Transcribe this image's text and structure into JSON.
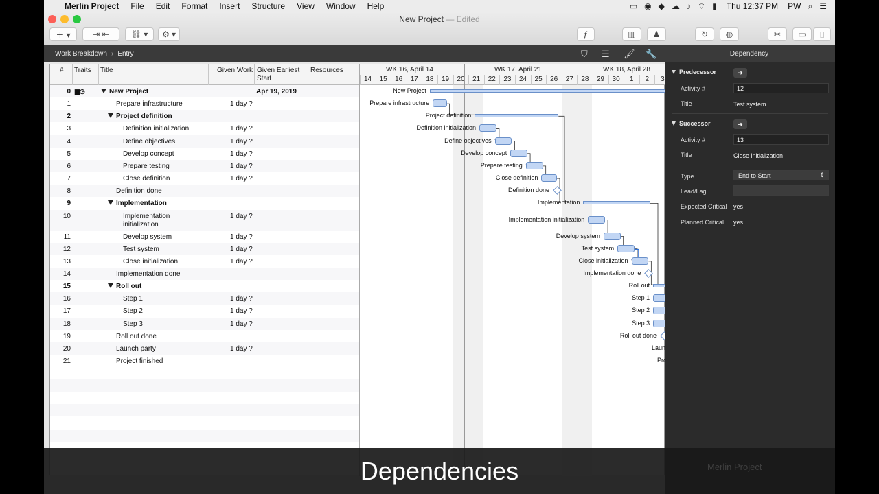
{
  "menubar": {
    "app": "Merlin Project",
    "items": [
      "File",
      "Edit",
      "Format",
      "Insert",
      "Structure",
      "View",
      "Window",
      "Help"
    ],
    "clock": "Thu 12:37 PM",
    "user": "PW"
  },
  "window": {
    "title": "New Project",
    "edited": "— Edited"
  },
  "breadcrumb": [
    "Work Breakdown",
    "Entry"
  ],
  "inspector_title": "Dependency",
  "columns": {
    "num": "#",
    "traits": "Traits",
    "title": "Title",
    "work": "Given Work",
    "start": "Given Earliest Start",
    "resources": "Resources"
  },
  "rows": [
    {
      "num": "0",
      "title": "New Project",
      "work": "",
      "start": "Apr 19, 2019",
      "level": 0,
      "group": true
    },
    {
      "num": "1",
      "title": "Prepare infrastructure",
      "work": "1 day ?",
      "start": "",
      "level": 1,
      "group": false
    },
    {
      "num": "2",
      "title": "Project definition",
      "work": "",
      "start": "",
      "level": 1,
      "group": true
    },
    {
      "num": "3",
      "title": "Definition initialization",
      "work": "1 day ?",
      "start": "",
      "level": 2,
      "group": false
    },
    {
      "num": "4",
      "title": "Define objectives",
      "work": "1 day ?",
      "start": "",
      "level": 2,
      "group": false
    },
    {
      "num": "5",
      "title": "Develop concept",
      "work": "1 day ?",
      "start": "",
      "level": 2,
      "group": false
    },
    {
      "num": "6",
      "title": "Prepare testing",
      "work": "1 day ?",
      "start": "",
      "level": 2,
      "group": false
    },
    {
      "num": "7",
      "title": "Close definition",
      "work": "1 day ?",
      "start": "",
      "level": 2,
      "group": false
    },
    {
      "num": "8",
      "title": "Definition done",
      "work": "",
      "start": "",
      "level": 1,
      "group": false
    },
    {
      "num": "9",
      "title": "Implementation",
      "work": "",
      "start": "",
      "level": 1,
      "group": true
    },
    {
      "num": "10",
      "title": "Implementation\ninitialization",
      "work": "1 day ?",
      "start": "",
      "level": 2,
      "group": false
    },
    {
      "num": "11",
      "title": "Develop system",
      "work": "1 day ?",
      "start": "",
      "level": 2,
      "group": false
    },
    {
      "num": "12",
      "title": "Test system",
      "work": "1 day ?",
      "start": "",
      "level": 2,
      "group": false
    },
    {
      "num": "13",
      "title": "Close initialization",
      "work": "1 day ?",
      "start": "",
      "level": 2,
      "group": false
    },
    {
      "num": "14",
      "title": "Implementation done",
      "work": "",
      "start": "",
      "level": 1,
      "group": false
    },
    {
      "num": "15",
      "title": "Roll out",
      "work": "",
      "start": "",
      "level": 1,
      "group": true
    },
    {
      "num": "16",
      "title": "Step 1",
      "work": "1 day ?",
      "start": "",
      "level": 2,
      "group": false
    },
    {
      "num": "17",
      "title": "Step 2",
      "work": "1 day ?",
      "start": "",
      "level": 2,
      "group": false
    },
    {
      "num": "18",
      "title": "Step 3",
      "work": "1 day ?",
      "start": "",
      "level": 2,
      "group": false
    },
    {
      "num": "19",
      "title": "Roll out done",
      "work": "",
      "start": "",
      "level": 1,
      "group": false
    },
    {
      "num": "20",
      "title": "Launch party",
      "work": "1 day ?",
      "start": "",
      "level": 1,
      "group": false
    },
    {
      "num": "21",
      "title": "Project finished",
      "work": "",
      "start": "",
      "level": 1,
      "group": false
    }
  ],
  "gantt": {
    "weeks": [
      "WK 16, April 14",
      "WK 17, April 21",
      "WK 18, April 28"
    ],
    "days": [
      "14",
      "15",
      "16",
      "17",
      "18",
      "19",
      "20",
      "21",
      "22",
      "23",
      "24",
      "25",
      "26",
      "27",
      "28",
      "29",
      "30",
      "1",
      "2",
      "3"
    ],
    "labels": [
      "New Project",
      "Prepare infrastructure",
      "Project definition",
      "Definition initialization",
      "Define objectives",
      "Develop concept",
      "Prepare testing",
      "Close definition",
      "Definition done",
      "Implementation",
      "Implementation initialization",
      "Develop system",
      "Test system",
      "Close initialization",
      "Implementation done",
      "Roll out",
      "Step 1",
      "Step 2",
      "Step 3",
      "Roll out done",
      "Launc",
      "Pro"
    ]
  },
  "inspector": {
    "predecessor": {
      "heading": "Predecessor",
      "activity_label": "Activity #",
      "activity": "12",
      "title_label": "Title",
      "title": "Test system"
    },
    "successor": {
      "heading": "Successor",
      "activity_label": "Activity #",
      "activity": "13",
      "title_label": "Title",
      "title": "Close initialization"
    },
    "type_label": "Type",
    "type": "End to Start",
    "lag_label": "Lead/Lag",
    "lag": "",
    "expected_label": "Expected Critical",
    "expected": "yes",
    "planned_label": "Planned Critical",
    "planned": "yes"
  },
  "caption": "Dependencies",
  "watermark": "Merlin Project"
}
